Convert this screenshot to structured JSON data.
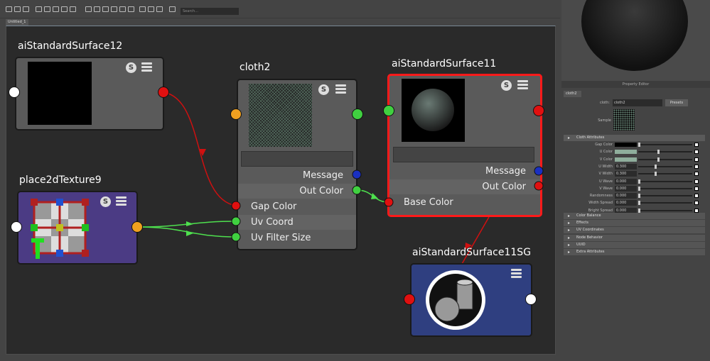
{
  "toolbar": {
    "search_placeholder": "Search..."
  },
  "tabs": [
    {
      "label": "Untitled_1"
    }
  ],
  "nodes": {
    "ss12": {
      "title": "aiStandardSurface12"
    },
    "place2d": {
      "title": "place2dTexture9"
    },
    "cloth": {
      "title": "cloth2",
      "rows": [
        "Message",
        "Out Color",
        "Gap Color",
        "Uv Coord",
        "Uv Filter Size"
      ]
    },
    "ss11": {
      "title": "aiStandardSurface11",
      "rows": [
        "Message",
        "Out Color",
        "Base Color"
      ]
    },
    "sg": {
      "title": "aiStandardSurface11SG"
    }
  },
  "property_editor": {
    "title": "Property Editor",
    "tab": "cloth2",
    "node_type_label": "cloth:",
    "node_name": "cloth2",
    "presets": "Presets",
    "sample_label": "Sample",
    "section": "Cloth Attributes",
    "attributes": [
      {
        "label": "Gap Color",
        "color": "#000000"
      },
      {
        "label": "U Color",
        "color": "#8fae9c"
      },
      {
        "label": "V Color",
        "color": "#8fae9c"
      },
      {
        "label": "U Width",
        "value": "0.300",
        "slider": 0.3
      },
      {
        "label": "V Width",
        "value": "0.300",
        "slider": 0.3
      },
      {
        "label": "U Wave",
        "value": "0.000",
        "slider": 0
      },
      {
        "label": "V Wave",
        "value": "0.000",
        "slider": 0
      },
      {
        "label": "Randomness",
        "value": "0.000",
        "slider": 0
      },
      {
        "label": "Width Spread",
        "value": "0.000",
        "slider": 0
      },
      {
        "label": "Bright Spread",
        "value": "0.000",
        "slider": 0
      }
    ],
    "collapsed_sections": [
      "Color Balance",
      "Effects",
      "UV Coordinates",
      "Node Behavior",
      "UUID",
      "Extra Attributes"
    ]
  },
  "colors": {
    "selected_border": "#ff1a1a",
    "place2d_bg": "#4b3b84",
    "sg_bg": "#2f3f80"
  }
}
